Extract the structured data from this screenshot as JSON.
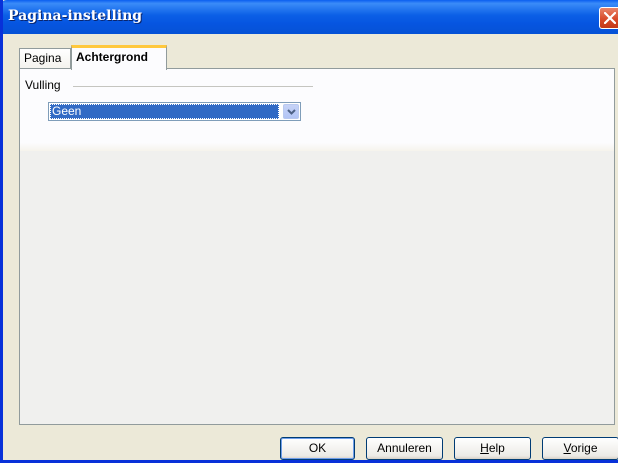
{
  "window": {
    "title": "Pagina-instelling",
    "title_bar_color": "#0a5ef0",
    "close_icon": "close-icon"
  },
  "tabs": [
    {
      "label": "Pagina",
      "active": false
    },
    {
      "label": "Achtergrond",
      "active": true
    }
  ],
  "fill_group": {
    "label": "Vulling",
    "select": {
      "value": "Geen",
      "arrow_icon": "chevron-down-icon"
    }
  },
  "buttons": {
    "ok": "OK",
    "cancel": "Annuleren",
    "help_first": "H",
    "help_rest": "elp",
    "back_first": "V",
    "back_rest": "orige"
  }
}
